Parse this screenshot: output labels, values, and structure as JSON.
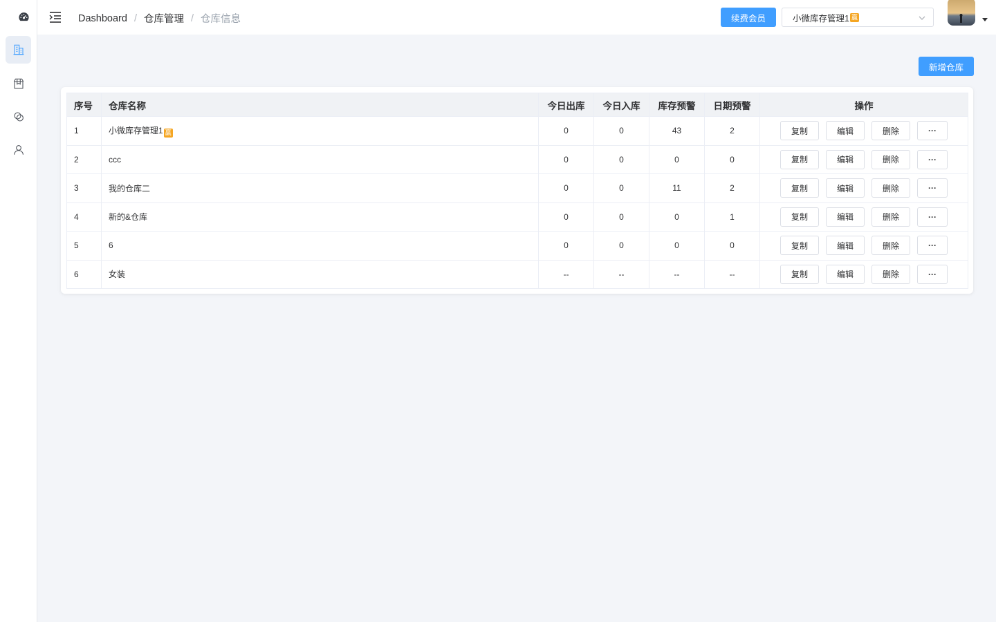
{
  "sidebar": {
    "items": [
      {
        "name": "warehouse-building-icon",
        "active": true
      },
      {
        "name": "box-icon",
        "active": false
      },
      {
        "name": "chat-icon",
        "active": false
      },
      {
        "name": "user-icon",
        "active": false
      }
    ]
  },
  "header": {
    "breadcrumb": [
      "Dashboard",
      "仓库管理",
      "仓库信息"
    ],
    "renew_label": "续费会员",
    "store_select_value": "小微库存管理1",
    "store_badge": "赢"
  },
  "toolbar": {
    "add_label": "新增仓库"
  },
  "table": {
    "headers": {
      "index": "序号",
      "name": "仓库名称",
      "out_today": "今日出库",
      "in_today": "今日入库",
      "stock_warning": "库存预警",
      "date_warning": "日期预警",
      "actions": "操作"
    },
    "action_labels": {
      "copy": "复制",
      "edit": "编辑",
      "delete": "删除",
      "more": "···"
    },
    "rows": [
      {
        "index": "1",
        "name": "小微库存管理1",
        "badge": "赢",
        "out_today": "0",
        "in_today": "0",
        "stock_warning": "43",
        "date_warning": "2"
      },
      {
        "index": "2",
        "name": "ccc",
        "out_today": "0",
        "in_today": "0",
        "stock_warning": "0",
        "date_warning": "0"
      },
      {
        "index": "3",
        "name": "我的仓库二",
        "out_today": "0",
        "in_today": "0",
        "stock_warning": "11",
        "date_warning": "2"
      },
      {
        "index": "4",
        "name": "新的&仓库",
        "out_today": "0",
        "in_today": "0",
        "stock_warning": "0",
        "date_warning": "1"
      },
      {
        "index": "5",
        "name": "6",
        "out_today": "0",
        "in_today": "0",
        "stock_warning": "0",
        "date_warning": "0"
      },
      {
        "index": "6",
        "name": "女装",
        "out_today": "--",
        "in_today": "--",
        "stock_warning": "--",
        "date_warning": "--"
      }
    ]
  },
  "colors": {
    "primary": "#409eff",
    "badge": "#f5a623",
    "sidebar_active": "#e8edf5",
    "background": "#f3f5f9"
  }
}
